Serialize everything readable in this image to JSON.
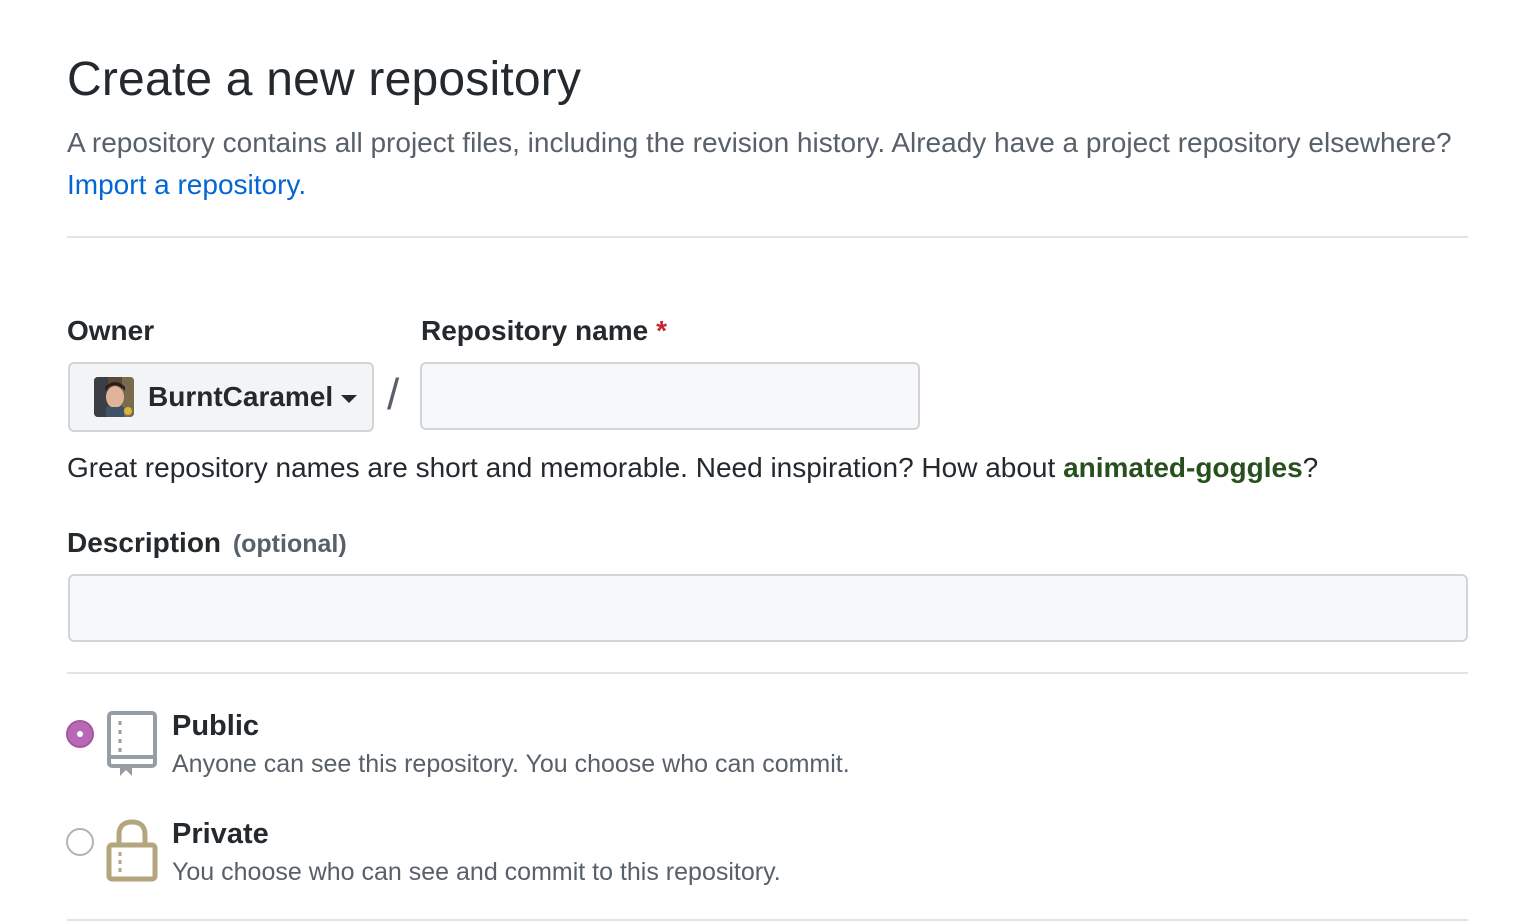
{
  "header": {
    "title": "Create a new repository",
    "description": "A repository contains all project files, including the revision history. Already have a project repository elsewhere?",
    "import_link": "Import a repository."
  },
  "owner": {
    "label": "Owner",
    "selected": "BurntCaramel"
  },
  "repo_name": {
    "label": "Repository name",
    "required_mark": "*",
    "value": ""
  },
  "separator": "/",
  "hint": {
    "prefix": "Great repository names are short and memorable. Need inspiration? How about ",
    "suggestion": "animated-goggles",
    "suffix": "?"
  },
  "description": {
    "label": "Description",
    "optional": "(optional)",
    "value": ""
  },
  "visibility": {
    "public": {
      "title": "Public",
      "desc": "Anyone can see this repository. You choose who can commit.",
      "checked": true
    },
    "private": {
      "title": "Private",
      "desc": "You choose who can see and commit to this repository.",
      "checked": false
    }
  },
  "colors": {
    "link": "#0366d6",
    "suggestion": "#28501f",
    "required": "#cb2431",
    "radio_checked": "#b869b6",
    "lock_icon": "#b3a57e"
  }
}
